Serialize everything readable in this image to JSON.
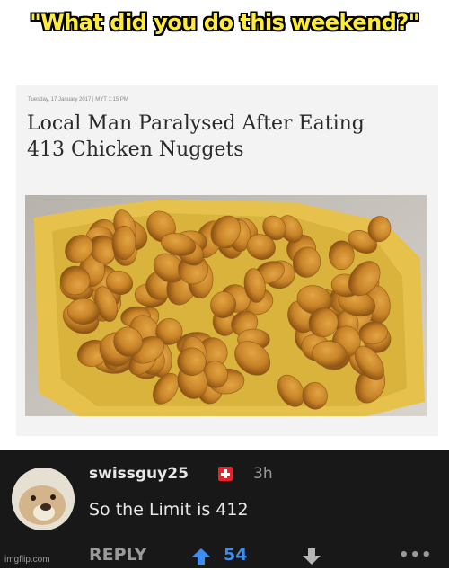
{
  "meme_caption": "\"What did you do this weekend?\"",
  "article": {
    "meta": "Tuesday, 17 January 2017 | MYT 1:15 PM",
    "headline_line1": "Local Man Paralysed After Eating",
    "headline_line2": "413 Chicken Nuggets"
  },
  "comment": {
    "username": "swissguy25",
    "time": "3h",
    "text": "So the Limit is 412",
    "reply_label": "REPLY",
    "upvote_count": "54",
    "more_label": "•••"
  },
  "icons": {
    "flag": "swiss-flag-icon",
    "upvote": "upvote-arrow-icon",
    "downvote": "downvote-arrow-icon",
    "more": "more-options-icon"
  },
  "colors": {
    "caption_text": "#ffeb3b",
    "comment_background": "#181818",
    "upvote_blue": "#3d8cf0",
    "flag_red": "#e8212b"
  },
  "watermark": "imgflip.com"
}
